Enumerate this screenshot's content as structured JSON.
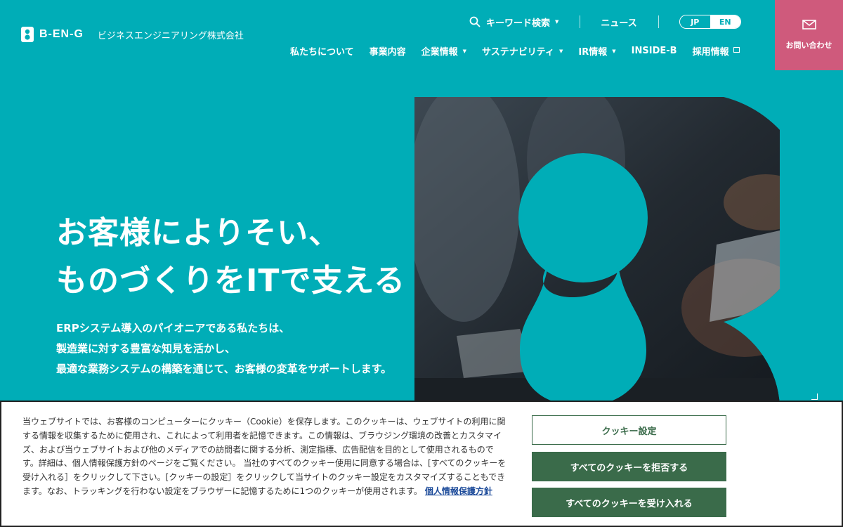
{
  "header": {
    "logo_text": "B-EN-G",
    "logo_sub": "ビジネスエンジニアリング株式会社",
    "search_label": "キーワード検索",
    "news_label": "ニュース",
    "lang": {
      "jp": "JP",
      "en": "EN",
      "active": "JP"
    },
    "nav": [
      {
        "label": "私たちについて"
      },
      {
        "label": "事業内容"
      },
      {
        "label": "企業情報"
      },
      {
        "label": "サステナビリティ"
      },
      {
        "label": "IR情報"
      },
      {
        "label": "INSIDE-B"
      },
      {
        "label": "採用情報"
      }
    ],
    "contact_label": "お問い合わせ"
  },
  "hero": {
    "title_line1": "お客様によりそい、",
    "title_line2": "ものづくりをITで支える",
    "desc_line1": "ERPシステム導入のパイオニアである私たちは、",
    "desc_line2": "製造業に対する豊富な知見を活かし、",
    "desc_line3": "最適な業務システムの構築を通じて、お客様の変革をサポートします。"
  },
  "cookie": {
    "text": "当ウェブサイトでは、お客様のコンピューターにクッキー（Cookie）を保存します。このクッキーは、ウェブサイトの利用に関する情報を収集するために使用され、これによって利用者を記憶できます。この情報は、ブラウジング環境の改善とカスタマイズ、および当ウェブサイトおよび他のメディアでの訪問者に関する分析、測定指標、広告配信を目的として使用されるものです。詳細は、個人情報保護方針のページをご覧ください。 当社のすべてのクッキー使用に同意する場合は、[すべてのクッキーを受け入れる］をクリックして下さい。[クッキーの設定］をクリックして当サイトのクッキー設定をカスタマイズすることもできます。なお、トラッキングを行わない設定をブラウザーに記憶するために1つのクッキーが使用されます。",
    "link_label": "個人情報保護方針",
    "settings_label": "クッキー設定",
    "reject_label": "すべてのクッキーを拒否する",
    "accept_label": "すべてのクッキーを受け入れる"
  },
  "colors": {
    "brand_teal": "#00adb7",
    "contact_pink": "#cf5a7c",
    "button_green": "#3a6b4a",
    "link_blue": "#1d4b9a"
  },
  "icons": [
    "logo-mark-icon",
    "search-icon",
    "chevron-down-icon",
    "external-link-icon",
    "mail-icon",
    "corner-icon"
  ]
}
